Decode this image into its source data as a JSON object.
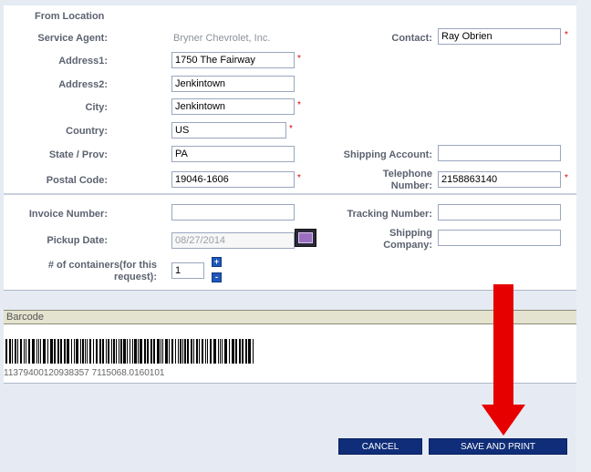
{
  "from_location": {
    "section_title": "From Location",
    "service_agent_label": "Service Agent:",
    "service_agent_value": "Bryner Chevrolet, Inc.",
    "contact_label": "Contact:",
    "contact_value": "Ray Obrien",
    "address1_label": "Address1:",
    "address1_value": "1750 The Fairway",
    "address2_label": "Address2:",
    "address2_value": "Jenkintown",
    "city_label": "City:",
    "city_value": "Jenkintown",
    "country_label": "Country:",
    "country_value": "US",
    "state_label": "State / Prov:",
    "state_value": "PA",
    "shipping_account_label": "Shipping Account:",
    "shipping_account_value": "",
    "postal_label": "Postal Code:",
    "postal_value": "19046-1606",
    "telephone_label_1": "Telephone",
    "telephone_label_2": "Number:",
    "telephone_value": "2158863140",
    "required_mark": "*"
  },
  "shipment": {
    "invoice_label": "Invoice Number:",
    "invoice_value": "",
    "tracking_label": "Tracking Number:",
    "tracking_value": "",
    "pickup_label": "Pickup Date:",
    "pickup_value": "08/27/2014",
    "shipping_company_label_1": "Shipping",
    "shipping_company_label_2": "Company:",
    "shipping_company_value": "",
    "containers_label_1": "# of containers(for this",
    "containers_label_2": "request):",
    "containers_value": "1"
  },
  "barcode": {
    "header": "Barcode",
    "number": "1137940012093835771150680160101",
    "caption": "11379400120938357 7115068.0160101"
  },
  "buttons": {
    "cancel": "CANCEL",
    "save_print": "SAVE AND PRINT"
  },
  "colors": {
    "button_bg": "#0f2d78",
    "arrow": "#e60000",
    "barcode_header_bg": "#e3e3cf"
  }
}
